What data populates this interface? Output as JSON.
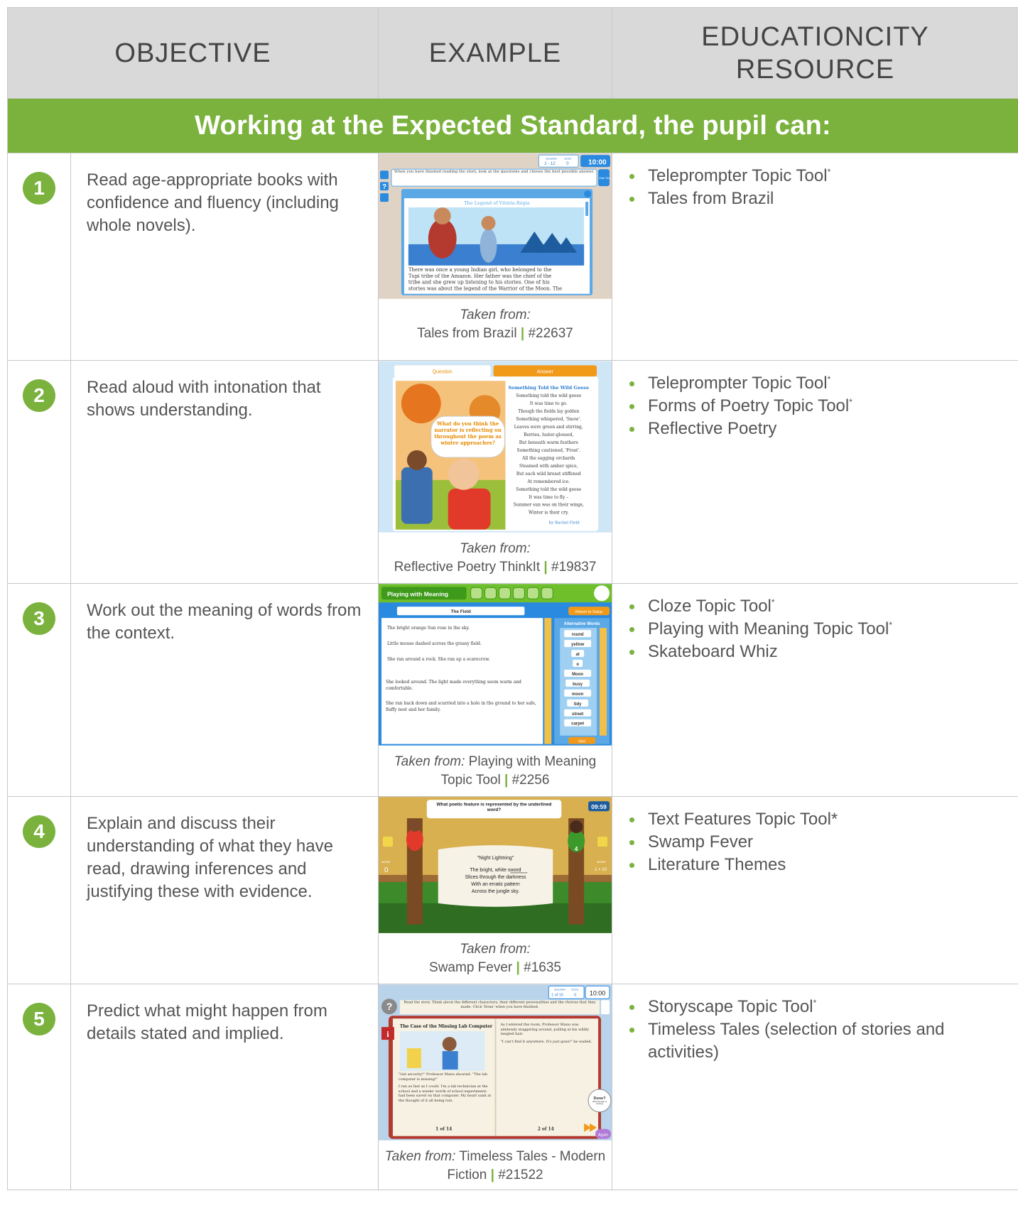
{
  "headers": {
    "objective": "OBJECTIVE",
    "example": "EXAMPLE",
    "resource_line1": "EDUCATIONCITY",
    "resource_line2": "RESOURCE"
  },
  "band": "Working at the Expected Standard, the pupil can:",
  "taken_from_label": "Taken from:",
  "colors": {
    "accent": "#7ab23d",
    "header_bg": "#d9d9d9"
  },
  "rows": [
    {
      "num": "1",
      "objective": "Read age-appropriate books with confidence and fluency (including whole novels).",
      "caption_title": "Tales from Brazil",
      "caption_id": "#22637",
      "shot": {
        "instruction": "When you have finished reading the story, look at the questions and choose the best possible answer.",
        "q_label": "Question",
        "q_value": "1 - 12",
        "s_label": "Score",
        "s_value": "0",
        "timer": "10:00",
        "story_title": "The Legend of Vitória-Régia",
        "story_text": [
          "There was once a young Indian girl, who belonged to the",
          "Tupi tribe of the Amazon. Her father was the chief of the",
          "tribe and she grew up listening to his stories. One of his",
          "stories was about the legend of the Warrior of the Moon. The"
        ],
        "hide_text": "Hide Text"
      },
      "resources": [
        "Teleprompter Topic Tool",
        "Tales from Brazil"
      ],
      "res_star": [
        true,
        false
      ]
    },
    {
      "num": "2",
      "objective": "Read aloud with intonation that shows understanding.",
      "caption_title": "Reflective Poetry ThinkIt",
      "caption_id": "#19837",
      "shot": {
        "tab_q": "Question",
        "tab_a": "Answer",
        "bubble": "What do you think the narrator is reflecting on throughout the poem as winter approaches?",
        "poem_title": "Something Told the Wild Geese",
        "poem": [
          "Something told the wild geese",
          "It was time to go.",
          "Though the fields lay golden",
          "Something whispered, 'Snow'.",
          "Leaves were green and stirring,",
          "Berries, luster-glossed,",
          "But beneath warm feathers",
          "Something cautioned, 'Frost'.",
          "All the sagging orchards",
          "Steamed with amber spice,",
          "But each wild breast stiffened",
          "At remembered ice.",
          "Something told the wild geese",
          "It was time to fly –",
          "Summer sun was on their wings,",
          "Winter is their cry."
        ],
        "author": "by Rachel Field"
      },
      "resources": [
        "Teleprompter Topic Tool",
        "Forms of Poetry Topic Tool",
        "Reflective Poetry"
      ],
      "res_star": [
        true,
        true,
        false
      ]
    },
    {
      "num": "3",
      "objective": "Work out the meaning of words from the context.",
      "caption_title": "Playing with Meaning Topic Tool",
      "caption_id": "#2256",
      "shot": {
        "app_title": "Playing with Meaning",
        "field": "The Field",
        "return": "Return to Setup",
        "alt_title": "Alternative Words",
        "hint": "Hint",
        "sentences": [
          "The bright orange Sun rose in the sky.",
          "Little mouse dashed across the grassy field.",
          "She ran around a rock. She ran up a scarecrow.",
          "She looked around. The light made everything seem warm and comfortable.",
          "She ran back down and scurried into a hole in the ground to her safe, fluffy nest and her family."
        ],
        "words": [
          "round",
          "yellow",
          "at",
          "o",
          "Moon",
          "busy",
          "moon",
          "tidy",
          "street",
          "carpet"
        ]
      },
      "resources": [
        "Cloze Topic Tool",
        "Playing with Meaning Topic Tool",
        "Skateboard Whiz"
      ],
      "res_star": [
        true,
        true,
        false
      ]
    },
    {
      "num": "4",
      "objective": "Explain and discuss their understanding of what they have read, drawing inferences and justifying these with evidence.",
      "caption_title": "Swamp Fever",
      "caption_id": "#1635",
      "shot": {
        "question": "What poetic feature is represented by the underlined word?",
        "timer": "09:59",
        "poem_title": "\"Night Lightning\"",
        "poem": [
          "The bright, white sword",
          "Slices through the darkness",
          "With an erratic pattern",
          "Across the jungle sky."
        ],
        "left_score_label": "score",
        "left_score": "0",
        "right_score_label": "score",
        "right_score": "1 × 10",
        "player_num": "4"
      },
      "resources": [
        "Text Features Topic Tool*",
        "Swamp Fever",
        "Literature Themes"
      ],
      "res_star": [
        false,
        false,
        false
      ]
    },
    {
      "num": "5",
      "objective": "Predict what might happen from details stated and implied.",
      "caption_title": "Timeless Tales - Modern Fiction",
      "caption_id": "#21522",
      "shot": {
        "instruction": "Read the story. Think about the different characters, their different personalities and the choices that they made. Click 'Done' when you have finished.",
        "q_label": "Question",
        "q_value": "1 of 10",
        "s_label": "Score",
        "s_value": "0",
        "timer": "10:00",
        "book_title": "The Case of the Missing Lab Computer",
        "left_text": [
          "\"Get security!\" Professor Manu shouted. \"The lab computer is missing!\"",
          "I ran as fast as I could. I'm a lab technician at the school and a weeks' worth of school experiments had been saved on that computer. My heart sank at the thought of it all being lost."
        ],
        "right_text": [
          "As I entered the room, Professor Manu was aimlessly staggering around, pulling at his wildly tangled hair.",
          "\"I can't find it anywhere. It's just gone!\" he wailed."
        ],
        "page_left": "1 of 14",
        "page_right": "2 of 14",
        "done": "Done?",
        "done_sub": "(Read all pages to continue)",
        "again": "Again"
      },
      "resources": [
        "Storyscape Topic Tool",
        "Timeless Tales (selection of stories and activities)"
      ],
      "res_star": [
        true,
        false
      ]
    }
  ]
}
